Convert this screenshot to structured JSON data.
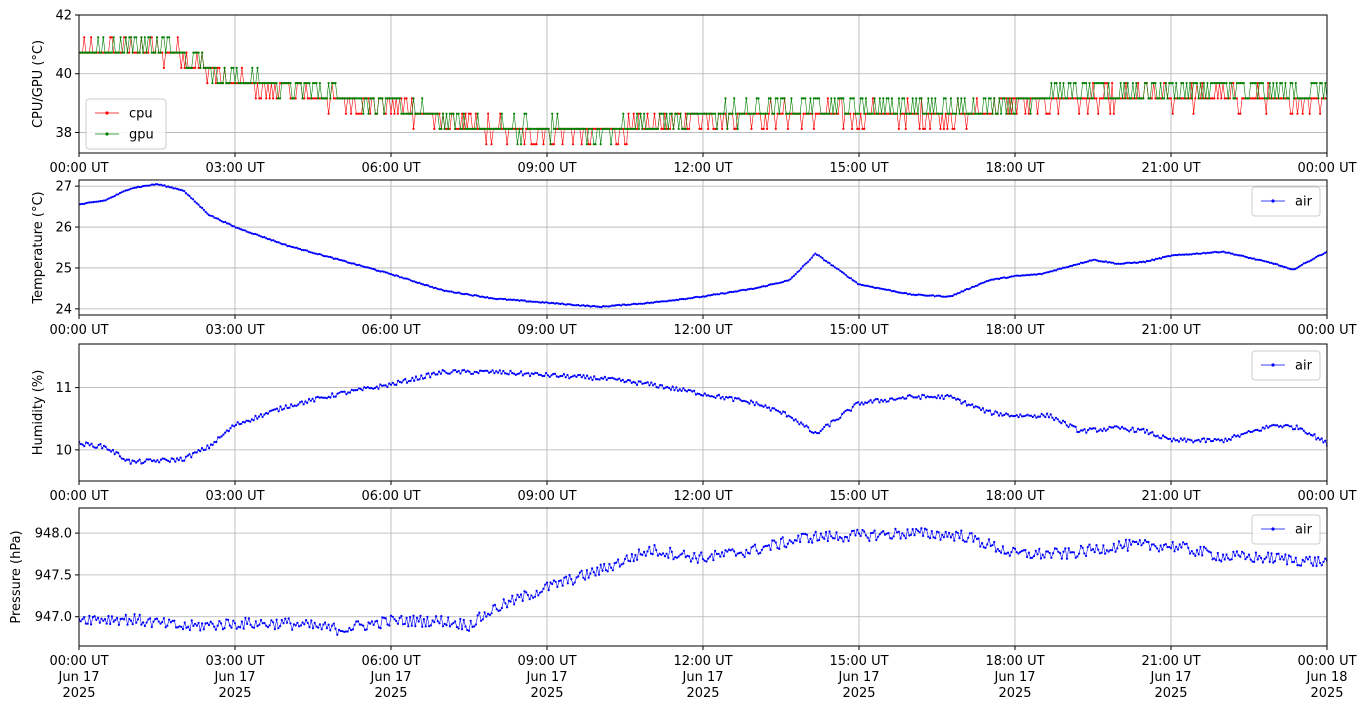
{
  "chart_data": [
    {
      "type": "line",
      "ylabel": "CPU/GPU (°C)",
      "ylim": [
        37.3,
        42.0
      ],
      "yticks": [
        38,
        40,
        42
      ],
      "ytick_labels": [
        "38",
        "40",
        "42"
      ],
      "xlim": [
        "2025-06-17T00:00",
        "2025-06-18T00:00"
      ],
      "xticks": [
        "2025-06-17T00:00",
        "2025-06-17T03:00",
        "2025-06-17T06:00",
        "2025-06-17T09:00",
        "2025-06-17T12:00",
        "2025-06-17T15:00",
        "2025-06-17T18:00",
        "2025-06-17T21:00",
        "2025-06-18T00:00"
      ],
      "xtick_labels": [
        "00:00 UT",
        "03:00 UT",
        "06:00 UT",
        "09:00 UT",
        "12:00 UT",
        "15:00 UT",
        "18:00 UT",
        "21:00 UT",
        "00:00 UT"
      ],
      "grid": true,
      "legend": "center-left",
      "series": [
        {
          "name": "cpu",
          "color": "#ff0000",
          "x": [
            "2025-06-17T00:00",
            "2025-06-17T01:00",
            "2025-06-17T02:00",
            "2025-06-17T02:30",
            "2025-06-17T03:00",
            "2025-06-17T04:00",
            "2025-06-17T05:00",
            "2025-06-17T06:00",
            "2025-06-17T07:00",
            "2025-06-17T08:00",
            "2025-06-17T09:00",
            "2025-06-17T10:00",
            "2025-06-17T11:00",
            "2025-06-17T12:00",
            "2025-06-17T13:00",
            "2025-06-17T14:00",
            "2025-06-17T15:00",
            "2025-06-17T16:00",
            "2025-06-17T17:00",
            "2025-06-17T18:00",
            "2025-06-17T19:00",
            "2025-06-17T20:00",
            "2025-06-17T21:00",
            "2025-06-17T22:00",
            "2025-06-17T23:00",
            "2025-06-18T00:00"
          ],
          "y": [
            40.7,
            40.8,
            40.7,
            40.1,
            39.7,
            39.4,
            39.1,
            39.0,
            38.3,
            38.1,
            38.0,
            38.0,
            38.2,
            38.6,
            38.6,
            38.6,
            38.6,
            38.6,
            38.6,
            39.0,
            39.1,
            39.1,
            39.2,
            39.2,
            39.1,
            39.2
          ]
        },
        {
          "name": "gpu",
          "color": "#008000",
          "x": [
            "2025-06-17T00:00",
            "2025-06-17T01:00",
            "2025-06-17T02:00",
            "2025-06-17T02:30",
            "2025-06-17T03:00",
            "2025-06-17T04:00",
            "2025-06-17T05:00",
            "2025-06-17T06:00",
            "2025-06-17T07:00",
            "2025-06-17T08:00",
            "2025-06-17T09:00",
            "2025-06-17T10:00",
            "2025-06-17T11:00",
            "2025-06-17T12:00",
            "2025-06-17T13:00",
            "2025-06-17T14:00",
            "2025-06-17T15:00",
            "2025-06-17T16:00",
            "2025-06-17T17:00",
            "2025-06-17T18:00",
            "2025-06-17T19:00",
            "2025-06-17T20:00",
            "2025-06-17T21:00",
            "2025-06-17T22:00",
            "2025-06-17T23:00",
            "2025-06-18T00:00"
          ],
          "y": [
            40.8,
            41.0,
            40.8,
            40.2,
            39.8,
            39.6,
            39.3,
            39.0,
            38.4,
            38.2,
            38.1,
            38.0,
            38.3,
            38.6,
            38.7,
            38.9,
            38.9,
            38.8,
            38.7,
            39.1,
            39.3,
            39.4,
            39.5,
            39.5,
            39.3,
            39.5
          ]
        }
      ]
    },
    {
      "type": "line",
      "ylabel": "Temperature (°C)",
      "ylim": [
        23.85,
        27.15
      ],
      "yticks": [
        24,
        25,
        26,
        27
      ],
      "ytick_labels": [
        "24",
        "25",
        "26",
        "27"
      ],
      "xlim": [
        "2025-06-17T00:00",
        "2025-06-18T00:00"
      ],
      "xticks": [
        "2025-06-17T00:00",
        "2025-06-17T03:00",
        "2025-06-17T06:00",
        "2025-06-17T09:00",
        "2025-06-17T12:00",
        "2025-06-17T15:00",
        "2025-06-17T18:00",
        "2025-06-17T21:00",
        "2025-06-18T00:00"
      ],
      "xtick_labels": [
        "00:00 UT",
        "03:00 UT",
        "06:00 UT",
        "09:00 UT",
        "12:00 UT",
        "15:00 UT",
        "18:00 UT",
        "21:00 UT",
        "00:00 UT"
      ],
      "grid": true,
      "legend": "top-right",
      "series": [
        {
          "name": "air",
          "color": "#0000ff",
          "x": [
            "2025-06-17T00:00",
            "2025-06-17T00:30",
            "2025-06-17T01:00",
            "2025-06-17T01:30",
            "2025-06-17T02:00",
            "2025-06-17T02:30",
            "2025-06-17T03:00",
            "2025-06-17T04:00",
            "2025-06-17T05:00",
            "2025-06-17T06:00",
            "2025-06-17T07:00",
            "2025-06-17T08:00",
            "2025-06-17T09:00",
            "2025-06-17T10:00",
            "2025-06-17T11:00",
            "2025-06-17T12:00",
            "2025-06-17T13:00",
            "2025-06-17T13:40",
            "2025-06-17T14:10",
            "2025-06-17T15:00",
            "2025-06-17T16:00",
            "2025-06-17T16:45",
            "2025-06-17T17:30",
            "2025-06-17T18:00",
            "2025-06-17T18:30",
            "2025-06-17T19:30",
            "2025-06-17T20:00",
            "2025-06-17T20:30",
            "2025-06-17T21:00",
            "2025-06-17T22:00",
            "2025-06-17T23:00",
            "2025-06-17T23:20",
            "2025-06-18T00:00"
          ],
          "y": [
            26.55,
            26.65,
            26.95,
            27.05,
            26.9,
            26.3,
            26.0,
            25.55,
            25.2,
            24.85,
            24.45,
            24.25,
            24.15,
            24.05,
            24.15,
            24.3,
            24.5,
            24.7,
            25.35,
            24.6,
            24.35,
            24.3,
            24.7,
            24.8,
            24.85,
            25.2,
            25.1,
            25.15,
            25.3,
            25.4,
            25.1,
            24.95,
            25.4
          ]
        }
      ]
    },
    {
      "type": "line",
      "ylabel": "Humidity (%)",
      "ylim": [
        9.5,
        11.7
      ],
      "yticks": [
        10,
        11
      ],
      "ytick_labels": [
        "10",
        "11"
      ],
      "xlim": [
        "2025-06-17T00:00",
        "2025-06-18T00:00"
      ],
      "xticks": [
        "2025-06-17T00:00",
        "2025-06-17T03:00",
        "2025-06-17T06:00",
        "2025-06-17T09:00",
        "2025-06-17T12:00",
        "2025-06-17T15:00",
        "2025-06-17T18:00",
        "2025-06-17T21:00",
        "2025-06-18T00:00"
      ],
      "xtick_labels": [
        "00:00 UT",
        "03:00 UT",
        "06:00 UT",
        "09:00 UT",
        "12:00 UT",
        "15:00 UT",
        "18:00 UT",
        "21:00 UT",
        "00:00 UT"
      ],
      "grid": true,
      "legend": "top-right",
      "series": [
        {
          "name": "air",
          "color": "#0000ff",
          "x": [
            "2025-06-17T00:00",
            "2025-06-17T00:30",
            "2025-06-17T01:00",
            "2025-06-17T02:00",
            "2025-06-17T02:30",
            "2025-06-17T03:00",
            "2025-06-17T04:00",
            "2025-06-17T05:00",
            "2025-06-17T06:00",
            "2025-06-17T07:00",
            "2025-06-17T08:00",
            "2025-06-17T09:00",
            "2025-06-17T10:00",
            "2025-06-17T11:00",
            "2025-06-17T12:00",
            "2025-06-17T13:00",
            "2025-06-17T13:40",
            "2025-06-17T14:10",
            "2025-06-17T15:00",
            "2025-06-17T16:00",
            "2025-06-17T16:45",
            "2025-06-17T17:30",
            "2025-06-17T18:00",
            "2025-06-17T18:40",
            "2025-06-17T19:15",
            "2025-06-17T20:00",
            "2025-06-17T20:30",
            "2025-06-17T21:00",
            "2025-06-17T22:00",
            "2025-06-17T23:00",
            "2025-06-17T23:30",
            "2025-06-18T00:00"
          ],
          "y": [
            10.1,
            10.05,
            9.8,
            9.85,
            10.05,
            10.4,
            10.7,
            10.9,
            11.05,
            11.25,
            11.25,
            11.2,
            11.15,
            11.05,
            10.9,
            10.75,
            10.55,
            10.25,
            10.75,
            10.85,
            10.85,
            10.6,
            10.55,
            10.55,
            10.3,
            10.35,
            10.3,
            10.15,
            10.15,
            10.4,
            10.35,
            10.1
          ]
        }
      ]
    },
    {
      "type": "line",
      "ylabel": "Pressure (hPa)",
      "ylim": [
        946.65,
        948.3
      ],
      "yticks": [
        947.0,
        947.5,
        948.0
      ],
      "ytick_labels": [
        "947.0",
        "947.5",
        "948.0"
      ],
      "xlim": [
        "2025-06-17T00:00",
        "2025-06-18T00:00"
      ],
      "xticks": [
        "2025-06-17T00:00",
        "2025-06-17T03:00",
        "2025-06-17T06:00",
        "2025-06-17T09:00",
        "2025-06-17T12:00",
        "2025-06-17T15:00",
        "2025-06-17T18:00",
        "2025-06-17T21:00",
        "2025-06-18T00:00"
      ],
      "xtick_labels": [
        [
          "00:00 UT",
          "Jun 17",
          "2025"
        ],
        [
          "03:00 UT",
          "Jun 17",
          "2025"
        ],
        [
          "06:00 UT",
          "Jun 17",
          "2025"
        ],
        [
          "09:00 UT",
          "Jun 17",
          "2025"
        ],
        [
          "12:00 UT",
          "Jun 17",
          "2025"
        ],
        [
          "15:00 UT",
          "Jun 17",
          "2025"
        ],
        [
          "18:00 UT",
          "Jun 17",
          "2025"
        ],
        [
          "21:00 UT",
          "Jun 17",
          "2025"
        ],
        [
          "00:00 UT",
          "Jun 18",
          "2025"
        ]
      ],
      "grid": true,
      "legend": "top-right",
      "series": [
        {
          "name": "air",
          "color": "#0000ff",
          "x": [
            "2025-06-17T00:00",
            "2025-06-17T01:00",
            "2025-06-17T02:00",
            "2025-06-17T03:00",
            "2025-06-17T04:00",
            "2025-06-17T05:00",
            "2025-06-17T06:00",
            "2025-06-17T07:00",
            "2025-06-17T07:30",
            "2025-06-17T08:00",
            "2025-06-17T09:00",
            "2025-06-17T10:00",
            "2025-06-17T11:00",
            "2025-06-17T12:00",
            "2025-06-17T13:00",
            "2025-06-17T14:00",
            "2025-06-17T15:00",
            "2025-06-17T16:00",
            "2025-06-17T17:00",
            "2025-06-17T18:00",
            "2025-06-17T19:00",
            "2025-06-17T20:00",
            "2025-06-17T21:00",
            "2025-06-17T22:00",
            "2025-06-17T23:00",
            "2025-06-18T00:00"
          ],
          "y": [
            946.98,
            946.97,
            946.88,
            946.92,
            946.92,
            946.85,
            946.95,
            946.95,
            946.9,
            947.1,
            947.35,
            947.55,
            947.8,
            947.7,
            947.8,
            947.95,
            947.97,
            948.0,
            947.97,
            947.75,
            947.75,
            947.85,
            947.85,
            947.72,
            947.7,
            947.65
          ]
        }
      ]
    }
  ]
}
